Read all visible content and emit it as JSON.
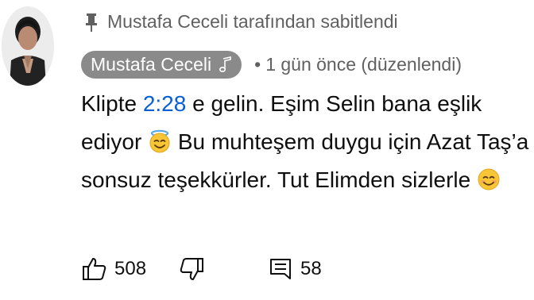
{
  "pinned": {
    "icon": "pin-icon",
    "text": "Mustafa Ceceli tarafından sabitlendi"
  },
  "comment": {
    "author": "Mustafa Ceceli",
    "author_icon": "music-note-icon",
    "meta_separator": "•",
    "meta": "1 gün önce (düzenlendi)",
    "body": {
      "part1": "Klipte ",
      "timestamp": "2:28",
      "part2": " e gelin. Eşim Selin bana eşlik ediyor ",
      "emoji1": "smiling-face-with-halo-emoji",
      "part3": " Bu muhteşem duygu için Azat Taş’a sonsuz teşekkürler. Tut Elimden sizlerle ",
      "emoji2": "smiling-face-emoji"
    }
  },
  "actions": {
    "like_count": "508",
    "reply_count": "58"
  },
  "colors": {
    "badge_bg": "#8a8a8a",
    "secondary_text": "#606060",
    "timestamp_link": "#065fd4"
  }
}
